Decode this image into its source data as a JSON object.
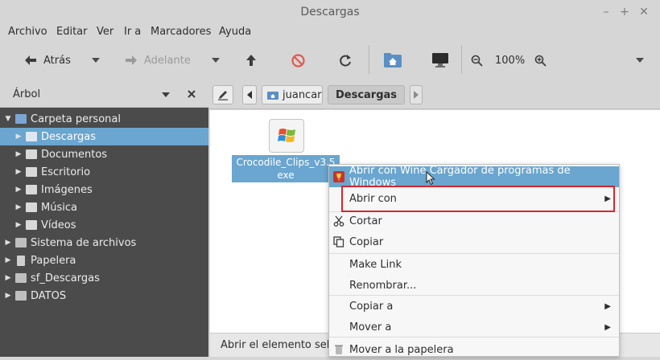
{
  "window": {
    "title": "Descargas",
    "controls": [
      "–",
      "+",
      "✕"
    ]
  },
  "menubar": {
    "items": [
      "Archivo",
      "Editar",
      "Ver",
      "Ir a",
      "Marcadores",
      "Ayuda"
    ]
  },
  "toolbar": {
    "back_label": "Atrás",
    "forward_label": "Adelante",
    "zoom_label": "100%"
  },
  "sidebar": {
    "title": "Árbol",
    "items": [
      {
        "label": "Carpeta personal",
        "level": 0,
        "expanded": true
      },
      {
        "label": "Descargas",
        "level": 1,
        "selected": true
      },
      {
        "label": "Documentos",
        "level": 1
      },
      {
        "label": "Escritorio",
        "level": 1
      },
      {
        "label": "Imágenes",
        "level": 1
      },
      {
        "label": "Música",
        "level": 1
      },
      {
        "label": "Vídeos",
        "level": 1
      },
      {
        "label": "Sistema de archivos",
        "level": 0
      },
      {
        "label": "Papelera",
        "level": 0
      },
      {
        "label": "sf_Descargas",
        "level": 0
      },
      {
        "label": "DATOS",
        "level": 0
      }
    ]
  },
  "pathbar": {
    "crumbs": [
      "juancar",
      "Descargas"
    ]
  },
  "file": {
    "name_line1": "Crocodile_Clips_v3.5",
    "name_line2": "exe"
  },
  "statusbar": {
    "text": "Abrir el elemento selec"
  },
  "context_menu": {
    "items": [
      {
        "label": "Abrir con Wine Cargador de programas de Windows",
        "highlighted": true
      },
      {
        "label": "Abrir con",
        "submenu": true
      },
      {
        "label": "Cortar"
      },
      {
        "label": "Copiar"
      },
      {
        "label": "Make Link"
      },
      {
        "label": "Renombrar..."
      },
      {
        "label": "Copiar a",
        "submenu": true
      },
      {
        "label": "Mover a",
        "submenu": true
      },
      {
        "label": "Mover a la papelera"
      }
    ]
  },
  "colors": {
    "selection": "#6aa6cf",
    "sidebar_bg": "#4b4b4b",
    "annotation_box": "#d9252e"
  }
}
